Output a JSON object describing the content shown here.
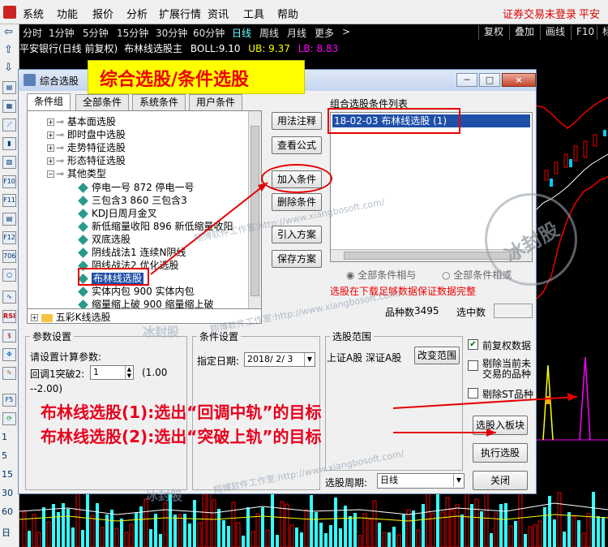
{
  "menu": {
    "items": [
      "系统",
      "功能",
      "报价",
      "分析",
      "扩展行情",
      "资讯",
      "工具",
      "帮助"
    ],
    "right": [
      "证券交易未登录",
      "平安银"
    ]
  },
  "periods": {
    "items": [
      "分时",
      "1分钟",
      "5分钟",
      "15分钟",
      "30分钟",
      "60分钟",
      "日线",
      "周线",
      "月线",
      "更多"
    ],
    "more_arrow": ">",
    "buttons": [
      "复权",
      "叠加",
      "画线",
      "F10",
      "标"
    ]
  },
  "infoline": {
    "stock": "平安银行(日线 前复权)",
    "indicator": "布林线选股主",
    "boll_label": "BOLL:",
    "boll_value": "9.10",
    "ub": "UB: 9.37",
    "lb": "LB: 8.83"
  },
  "lefttool": {
    "icon_labels": [
      "F10",
      "F11",
      "F12",
      "706",
      "RSI",
      "F5"
    ],
    "numbers": [
      "1",
      "5",
      "15",
      "30",
      "60"
    ],
    "bottom": "日"
  },
  "banner": {
    "text": "综合选股/条件选股"
  },
  "dialog": {
    "title": "综合选股",
    "win_min": "─",
    "win_max": "□",
    "win_close": "×",
    "tabs": [
      "条件组",
      "全部条件",
      "系统条件",
      "用户条件"
    ],
    "tree": {
      "top_nodes": [
        "基本面选股",
        "即时盘中选股",
        "走势特征选股",
        "形态特征选股",
        "其他类型"
      ],
      "leaves": [
        "停电一号 872 停电一号",
        "三包含3 860 三包含3",
        "KDJ日周月金叉",
        "新低缩量收阳 896 新低缩量收阳",
        "双底选股",
        "阴线战法1 连续N阴线",
        "阴线战法2 优化选股",
        "布林线选股",
        "实体内包 900 实体内包",
        "缩量缩上破 900 缩量缩上破"
      ],
      "bottom_node": "五彩K线选股",
      "selected_leaf": "布林线选股"
    },
    "buttons": {
      "usage": "用法注释",
      "formula": "查看公式",
      "add": "加入条件",
      "delete": "删除条件",
      "import": "引入方案",
      "save": "保存方案"
    },
    "cond_list": {
      "header": "组合选股条件列表",
      "items": [
        "18-02-03 布林线选股 (1)"
      ]
    },
    "radio_all_and": "全部条件相与",
    "radio_all_or": "全部条件相或",
    "warning": "选股在下载足够数据保证数据完整",
    "count": {
      "label": "品种数",
      "value": "3495",
      "chosen_label": "选中数"
    },
    "params": {
      "title": "参数设置",
      "prompt": "请设置计算参数:",
      "param_label": "回调1突破2:",
      "param_value": "1",
      "range": "(1.00",
      "range2": "--2.00)"
    },
    "condset": {
      "title": "条件设置",
      "date_label": "指定日期:",
      "date_value": "2018/ 2/ 3"
    },
    "scope": {
      "title": "选股范围",
      "value": "上证A股 深证A股",
      "change_btn": "改变范围"
    },
    "checks": {
      "prior_rights": "前复权数据",
      "exclude_suspended": "剔除当前未交易的品种",
      "exclude_st": "剔除ST品种"
    },
    "select_into_board": "选股入板块",
    "execute": "执行选股",
    "period_label": "选股周期:",
    "period_value": "日线",
    "close": "关闭"
  },
  "notes": {
    "line1": "布林线选股(1):选出“回调中轨”的目标",
    "line2": "布林线选股(2):选出“突破上轨”的目标"
  },
  "watermark": {
    "site": "翔博软件工作室:http://www.xiangbosoft.com/",
    "name": "冰封股",
    "site2": "翔博软件工作室:http://www.xiangbosoft.com/",
    "site3": "翔博软件工作室:http://www.xiangbosoft.com/",
    "stamp": "冰封股"
  }
}
